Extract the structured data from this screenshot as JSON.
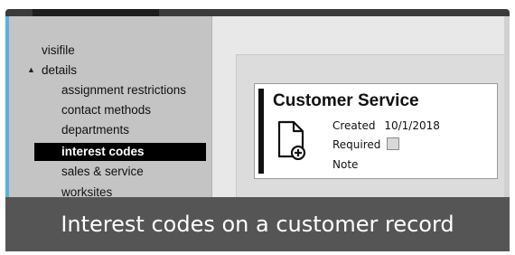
{
  "sidebar": {
    "top_items": [
      {
        "label": "visifile"
      },
      {
        "label": "details",
        "expanded": true
      }
    ],
    "sub_items": [
      {
        "label": "assignment restrictions"
      },
      {
        "label": "contact methods"
      },
      {
        "label": "departments"
      },
      {
        "label": "interest codes",
        "active": true
      },
      {
        "label": "sales & service"
      },
      {
        "label": "worksites"
      }
    ],
    "caret_icon": "▲"
  },
  "card": {
    "title": "Customer Service",
    "icon": "document-add-icon",
    "created_label": "Created",
    "created_value": "10/1/2018",
    "required_label": "Required",
    "required_checked": false,
    "note_label": "Note"
  },
  "caption": "Interest codes on a customer record",
  "colors": {
    "accent": "#5ab0df",
    "active_bg": "#000000",
    "caption_bg": "#555555"
  }
}
